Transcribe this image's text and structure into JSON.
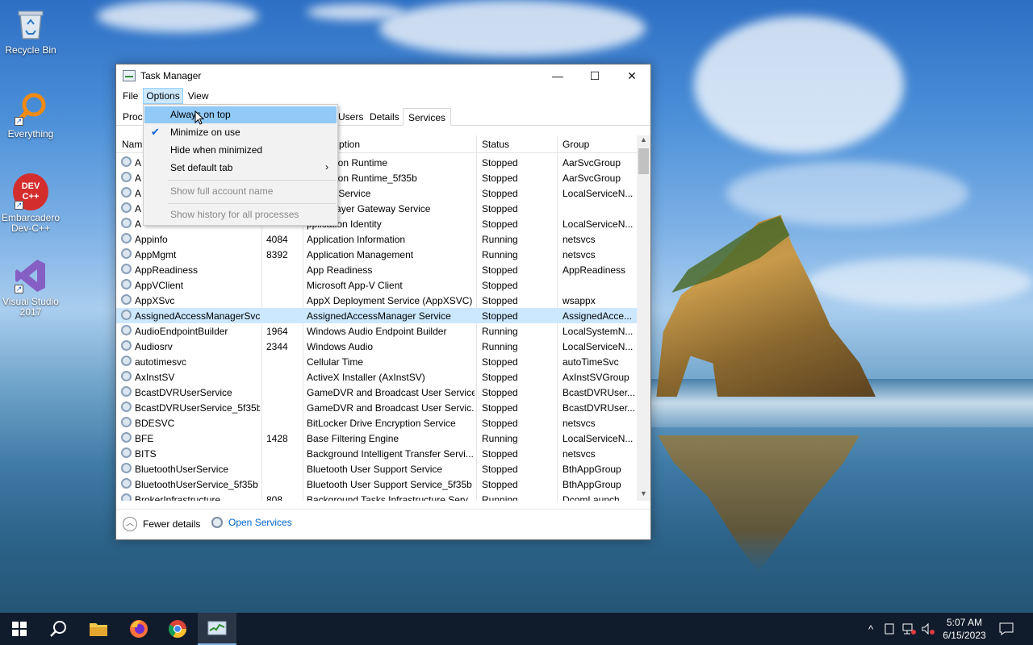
{
  "desktop": {
    "icons": [
      {
        "label": "Recycle Bin"
      },
      {
        "label": "Everything"
      },
      {
        "label": "Embarcadero Dev-C++",
        "badge": "DEV C++"
      },
      {
        "label": "Visual Studio 2017"
      }
    ]
  },
  "window": {
    "title": "Task Manager",
    "menu": [
      "File",
      "Options",
      "View"
    ],
    "tabs": [
      "Proc",
      "Users",
      "Details",
      "Services"
    ],
    "selected_tab": "Services",
    "columns": {
      "name": "Nam",
      "pid": "",
      "description": "ption",
      "status": "Status",
      "group": "Group"
    },
    "rows": [
      {
        "name": "A",
        "pid": "",
        "desc": "Activation Runtime",
        "status": "Stopped",
        "group": "AarSvcGroup"
      },
      {
        "name": "A",
        "pid": "",
        "desc": "Activation Runtime_5f35b",
        "status": "Stopped",
        "group": "AarSvcGroup"
      },
      {
        "name": "A",
        "pid": "",
        "desc": "Router Service",
        "status": "Stopped",
        "group": "LocalServiceN..."
      },
      {
        "name": "A",
        "pid": "",
        "desc": "ation Layer Gateway Service",
        "status": "Stopped",
        "group": ""
      },
      {
        "name": "A",
        "pid": "",
        "desc": "pplication Identity",
        "status": "Stopped",
        "group": "LocalServiceN..."
      },
      {
        "name": "Appinfo",
        "pid": "4084",
        "desc": "Application Information",
        "status": "Running",
        "group": "netsvcs"
      },
      {
        "name": "AppMgmt",
        "pid": "8392",
        "desc": "Application Management",
        "status": "Running",
        "group": "netsvcs"
      },
      {
        "name": "AppReadiness",
        "pid": "",
        "desc": "App Readiness",
        "status": "Stopped",
        "group": "AppReadiness"
      },
      {
        "name": "AppVClient",
        "pid": "",
        "desc": "Microsoft App-V Client",
        "status": "Stopped",
        "group": ""
      },
      {
        "name": "AppXSvc",
        "pid": "",
        "desc": "AppX Deployment Service (AppXSVC)",
        "status": "Stopped",
        "group": "wsappx"
      },
      {
        "name": "AssignedAccessManagerSvc",
        "pid": "",
        "desc": "AssignedAccessManager Service",
        "status": "Stopped",
        "group": "AssignedAcce..."
      },
      {
        "name": "AudioEndpointBuilder",
        "pid": "1964",
        "desc": "Windows Audio Endpoint Builder",
        "status": "Running",
        "group": "LocalSystemN..."
      },
      {
        "name": "Audiosrv",
        "pid": "2344",
        "desc": "Windows Audio",
        "status": "Running",
        "group": "LocalServiceN..."
      },
      {
        "name": "autotimesvc",
        "pid": "",
        "desc": "Cellular Time",
        "status": "Stopped",
        "group": "autoTimeSvc"
      },
      {
        "name": "AxInstSV",
        "pid": "",
        "desc": "ActiveX Installer (AxInstSV)",
        "status": "Stopped",
        "group": "AxInstSVGroup"
      },
      {
        "name": "BcastDVRUserService",
        "pid": "",
        "desc": "GameDVR and Broadcast User Service",
        "status": "Stopped",
        "group": "BcastDVRUser..."
      },
      {
        "name": "BcastDVRUserService_5f35b",
        "pid": "",
        "desc": "GameDVR and Broadcast User Servic...",
        "status": "Stopped",
        "group": "BcastDVRUser..."
      },
      {
        "name": "BDESVC",
        "pid": "",
        "desc": "BitLocker Drive Encryption Service",
        "status": "Stopped",
        "group": "netsvcs"
      },
      {
        "name": "BFE",
        "pid": "1428",
        "desc": "Base Filtering Engine",
        "status": "Running",
        "group": "LocalServiceN..."
      },
      {
        "name": "BITS",
        "pid": "",
        "desc": "Background Intelligent Transfer Servi...",
        "status": "Stopped",
        "group": "netsvcs"
      },
      {
        "name": "BluetoothUserService",
        "pid": "",
        "desc": "Bluetooth User Support Service",
        "status": "Stopped",
        "group": "BthAppGroup"
      },
      {
        "name": "BluetoothUserService_5f35b",
        "pid": "",
        "desc": "Bluetooth User Support Service_5f35b",
        "status": "Stopped",
        "group": "BthAppGroup"
      },
      {
        "name": "BrokerInfrastructure",
        "pid": "808",
        "desc": "Background Tasks Infrastructure Serv...",
        "status": "Running",
        "group": "DcomLaunch"
      }
    ],
    "selected_row": "AssignedAccessManagerSvc",
    "footer": {
      "fewer_details": "Fewer details",
      "open_services": "Open Services"
    }
  },
  "options_menu": {
    "items": [
      {
        "label": "Always on top",
        "checked": false,
        "highlighted": true,
        "disabled": false
      },
      {
        "label": "Minimize on use",
        "checked": true,
        "highlighted": false,
        "disabled": false
      },
      {
        "label": "Hide when minimized",
        "checked": false,
        "highlighted": false,
        "disabled": false
      },
      {
        "label": "Set default tab",
        "checked": false,
        "highlighted": false,
        "disabled": false,
        "submenu": true
      },
      {
        "label": "Show full account name",
        "checked": false,
        "highlighted": false,
        "disabled": true
      },
      {
        "label": "Show history for all processes",
        "checked": false,
        "highlighted": false,
        "disabled": true
      }
    ]
  },
  "taskbar": {
    "apps": [
      "start-icon",
      "search-icon",
      "file-explorer-icon",
      "firefox-icon",
      "chrome-icon",
      "task-manager-icon"
    ],
    "time": "5:07 AM",
    "date": "6/15/2023"
  },
  "colors": {
    "accent_selection": "#cce8ff",
    "menu_highlight": "#91c9f7",
    "link": "#0066cc",
    "taskbar": "#101b2b"
  }
}
